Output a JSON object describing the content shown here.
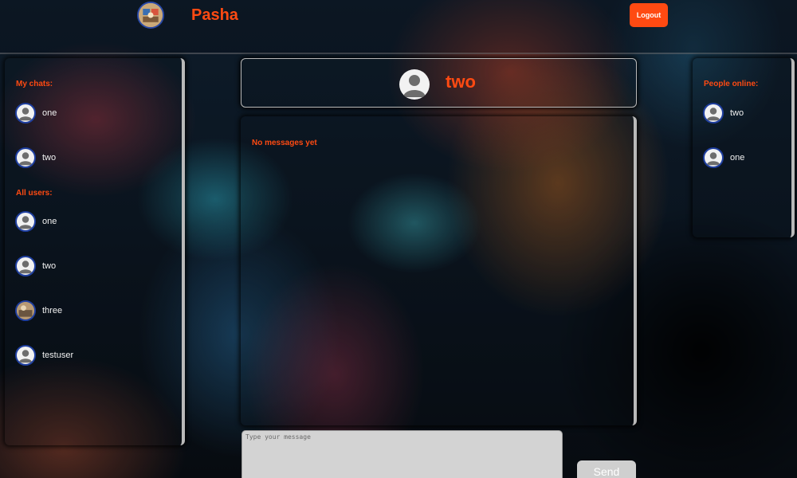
{
  "header": {
    "username": "Pasha",
    "logout_label": "Logout"
  },
  "sidebar": {
    "my_chats_title": "My chats:",
    "my_chats": [
      {
        "name": "one",
        "avatar": "default-user-icon"
      },
      {
        "name": "two",
        "avatar": "default-user-icon"
      }
    ],
    "all_users_title": "All users:",
    "all_users": [
      {
        "name": "one",
        "avatar": "default-user-icon"
      },
      {
        "name": "two",
        "avatar": "default-user-icon"
      },
      {
        "name": "three",
        "avatar": "photo"
      },
      {
        "name": "testuser",
        "avatar": "default-user-icon"
      }
    ]
  },
  "chat": {
    "partner_name": "two",
    "empty_text": "No messages yet",
    "input_placeholder": "Type your message",
    "send_label": "Send"
  },
  "online": {
    "title": "People online:",
    "users": [
      {
        "name": "two",
        "avatar": "default-user-icon"
      },
      {
        "name": "one",
        "avatar": "default-user-icon"
      }
    ]
  },
  "colors": {
    "accent": "#ff4a12",
    "panel_border": "#b9b9b9",
    "avatar_ring": "#1f3fa0"
  }
}
